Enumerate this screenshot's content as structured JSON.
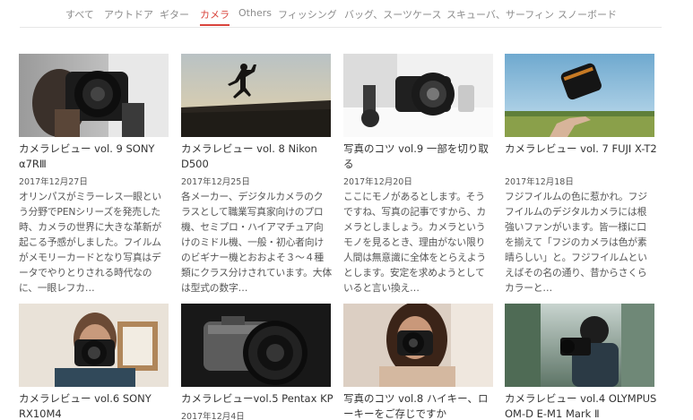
{
  "categories": [
    {
      "label": "すべて",
      "active": false
    },
    {
      "label": "アウトドア",
      "active": false
    },
    {
      "label": "ギター",
      "active": false
    },
    {
      "label": "カメラ",
      "active": true
    },
    {
      "label": "Others",
      "active": false
    },
    {
      "label": "フィッシング",
      "active": false
    },
    {
      "label": "バッグ、スーツケース",
      "active": false
    },
    {
      "label": "スキューバ、サーフィン",
      "active": false
    },
    {
      "label": "スノーボード",
      "active": false
    }
  ],
  "colors": {
    "accent": "#d9443c",
    "rule": "#e6e6e6"
  },
  "articles": [
    {
      "title": "カメラレビュー vol. 9 SONY α7RⅢ",
      "date": "2017年12月27日",
      "excerpt": "オリンパスがミラーレス一眼という分野でPENシリーズを発売した時、カメラの世界に大きな革新が起こる予感がしました。フイルムがメモリーカードとなり写真はデータでやりとりされる時代なのに、一眼レフカ…",
      "image": "camera-held-at-eye-photo"
    },
    {
      "title": "カメラレビュー vol. 8 Nikon D500",
      "date": "2017年12月25日",
      "excerpt": "各メーカー、デジタルカメラのクラスとして職業写真家向けのプロ機、セミプロ・ハイアマチュア向けのミドル機、一般・初心者向けのビギナー機とおおよそ３～４種類にクラス分けされています。大体は型式の数字…",
      "image": "jumping-silhouette-photo"
    },
    {
      "title": "写真のコツ vol.9 一部を切り取る",
      "date": "2017年12月20日",
      "excerpt": "ここにモノがあるとします。そうですね、写真の記事ですから、カメラとしましょう。カメラというモノを見るとき、理由がない限り人間は無意識に全体をとらえようとします。安定を求めようとしていると言い換え…",
      "image": "camera-on-table-photo"
    },
    {
      "title": "カメラレビュー vol. 7 FUJI X-T2",
      "date": "2017年12月18日",
      "excerpt": "フジフイルムの色に惹かれ。フジフイルムのデジタルカメラには根強いファンがいます。皆一様に口を揃えて「フジのカメラは色が素晴らしい」と。フジフイルムといえばその名の通り、昔からさくらカラーと…",
      "image": "lens-thrown-in-air-photo"
    },
    {
      "title": "カメラレビュー vol.6 SONY RX10M4",
      "date": "",
      "excerpt": "",
      "image": "man-with-camera-photo"
    },
    {
      "title": "カメラレビューvol.5 Pentax KP",
      "date": "2017年12月4日",
      "excerpt": "",
      "image": "pentax-camera-photo"
    },
    {
      "title": "写真のコツ vol.8 ハイキー、ローキーをご存じですか",
      "date": "",
      "excerpt": "",
      "image": "woman-with-camera-photo"
    },
    {
      "title": "カメラレビュー vol.4 OLYMPUS OM-D E-M1 Mark Ⅱ",
      "date": "",
      "excerpt": "",
      "image": "outdoor-photographer-photo"
    }
  ]
}
